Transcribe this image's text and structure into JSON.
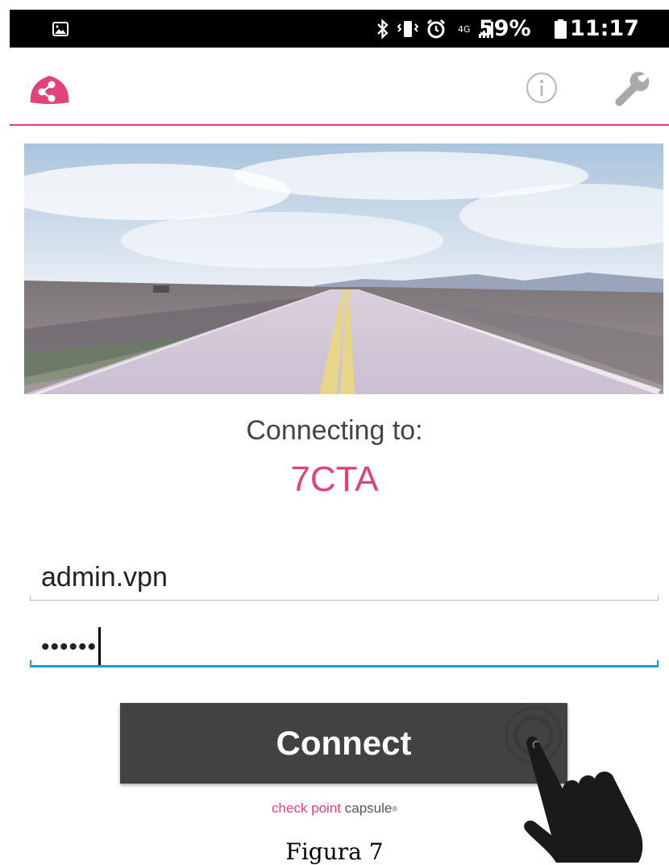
{
  "status_bar": {
    "battery": "59%",
    "time": "11:17",
    "network": "4G",
    "icons": [
      "image-icon",
      "bluetooth-icon",
      "vibrate-icon",
      "alarm-icon",
      "network-4g-icon",
      "signal-icon",
      "battery-icon"
    ]
  },
  "app_bar": {
    "logo_icon": "capsule-logo-icon",
    "actions": [
      "info-icon",
      "wrench-icon"
    ],
    "accent_color": "#dd3f74"
  },
  "connection": {
    "label": "Connecting to:",
    "gateway": "7CTA",
    "gateway_color": "#e2427a"
  },
  "form": {
    "username": "admin.vpn",
    "password_mask": "••••••",
    "focus_color": "#1e9bd3"
  },
  "connect_button": {
    "label": "Connect"
  },
  "brand": {
    "part1": "check point",
    "part2": "capsule",
    "mark": "®"
  },
  "caption": "Figura 7"
}
